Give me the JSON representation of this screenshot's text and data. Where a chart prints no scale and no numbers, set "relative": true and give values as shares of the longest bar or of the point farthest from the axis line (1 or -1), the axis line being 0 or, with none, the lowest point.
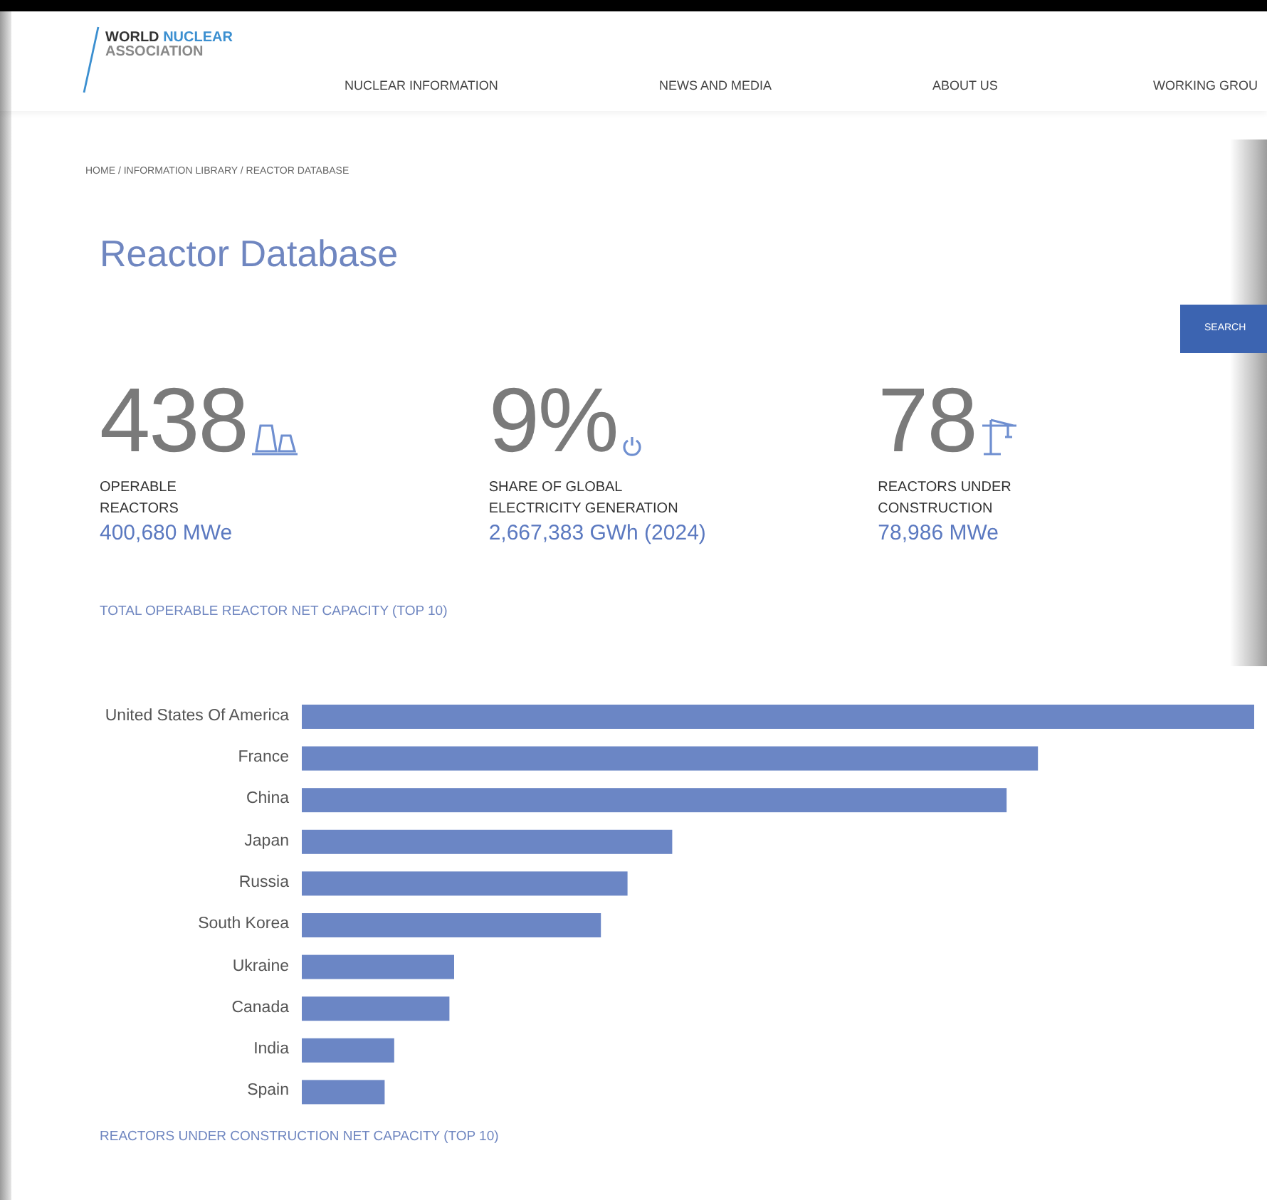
{
  "header": {
    "logo": {
      "words": [
        "WORLD",
        "NUCLEAR"
      ],
      "subtitle": "ASSOCIATION"
    },
    "nav": [
      "NUCLEAR INFORMATION",
      "NEWS AND MEDIA",
      "ABOUT US",
      "WORKING GROU"
    ]
  },
  "breadcrumb": "HOME / INFORMATION LIBRARY / REACTOR DATABASE",
  "title": "Reactor Database",
  "search_button": "SEARCH",
  "stats": [
    {
      "kind": "towers",
      "number": "438",
      "label_lines": [
        "OPERABLE",
        "REACTORS"
      ],
      "value": "400,680 MWe"
    },
    {
      "kind": "power",
      "number": "9%",
      "label_lines": [
        "SHARE OF GLOBAL",
        "ELECTRICITY GENERATION"
      ],
      "value": "2,667,383 GWh (2024)"
    },
    {
      "kind": "crane",
      "number": "78",
      "label_lines": [
        "REACTORS UNDER",
        "CONSTRUCTION"
      ],
      "value": "78,986 MWe"
    }
  ],
  "capacity_chart": {
    "title": "TOTAL OPERABLE REACTOR NET CAPACITY (TOP 10)",
    "chart_data": {
      "type": "bar",
      "orientation": "horizontal",
      "categories": [
        "United States Of America",
        "France",
        "China",
        "Japan",
        "Russia",
        "South Korea",
        "Ukraine",
        "Canada",
        "India",
        "Spain"
      ],
      "values": [
        1,
        0.773,
        0.74,
        0.389,
        0.342,
        0.314,
        0.16,
        0.155,
        0.097,
        0.087
      ],
      "relative": true
    }
  },
  "next_section": {
    "title": "REACTORS UNDER CONSTRUCTION NET CAPACITY (TOP 10)"
  }
}
